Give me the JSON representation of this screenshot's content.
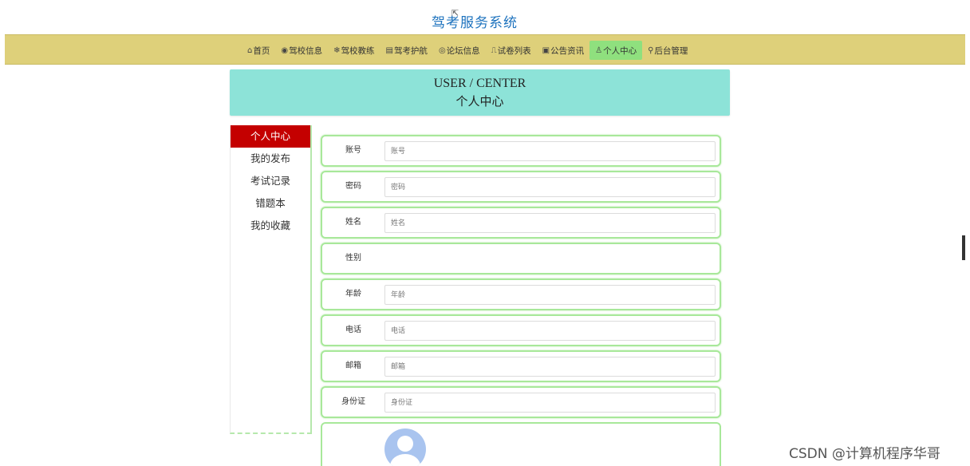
{
  "site": {
    "title": "驾考服务系统"
  },
  "nav": {
    "items": [
      {
        "icon": "⌂",
        "label": "首页",
        "active": false
      },
      {
        "icon": "◉",
        "label": "驾校信息",
        "active": false
      },
      {
        "icon": "❄",
        "label": "驾校教练",
        "active": false
      },
      {
        "icon": "▤",
        "label": "驾考护航",
        "active": false
      },
      {
        "icon": "◎",
        "label": "论坛信息",
        "active": false
      },
      {
        "icon": "⎍",
        "label": "试卷列表",
        "active": false
      },
      {
        "icon": "▣",
        "label": "公告资讯",
        "active": false
      },
      {
        "icon": "♙",
        "label": "个人中心",
        "active": true
      },
      {
        "icon": "⚲",
        "label": "后台管理",
        "active": false
      }
    ],
    "active_color": "#8fe07e",
    "bar_color": "#ded07a"
  },
  "banner": {
    "title_en": "USER / CENTER",
    "title_cn": "个人中心",
    "color": "#8de3d8"
  },
  "sidebar": {
    "items": [
      {
        "label": "个人中心",
        "active": true
      },
      {
        "label": "我的发布",
        "active": false
      },
      {
        "label": "考试记录",
        "active": false
      },
      {
        "label": "错题本",
        "active": false
      },
      {
        "label": "我的收藏",
        "active": false
      }
    ],
    "active_color": "#c40000"
  },
  "form": {
    "fields": [
      {
        "label": "账号",
        "placeholder": "账号",
        "value": ""
      },
      {
        "label": "密码",
        "placeholder": "密码",
        "value": ""
      },
      {
        "label": "姓名",
        "placeholder": "姓名",
        "value": ""
      },
      {
        "label": "性别",
        "placeholder": "",
        "value": ""
      },
      {
        "label": "年龄",
        "placeholder": "年龄",
        "value": ""
      },
      {
        "label": "电话",
        "placeholder": "电话",
        "value": ""
      },
      {
        "label": "邮箱",
        "placeholder": "邮箱",
        "value": ""
      },
      {
        "label": "身份证",
        "placeholder": "身份证",
        "value": ""
      }
    ],
    "avatar_icon": "user-avatar-placeholder"
  },
  "watermark": "CSDN @计算机程序华哥"
}
